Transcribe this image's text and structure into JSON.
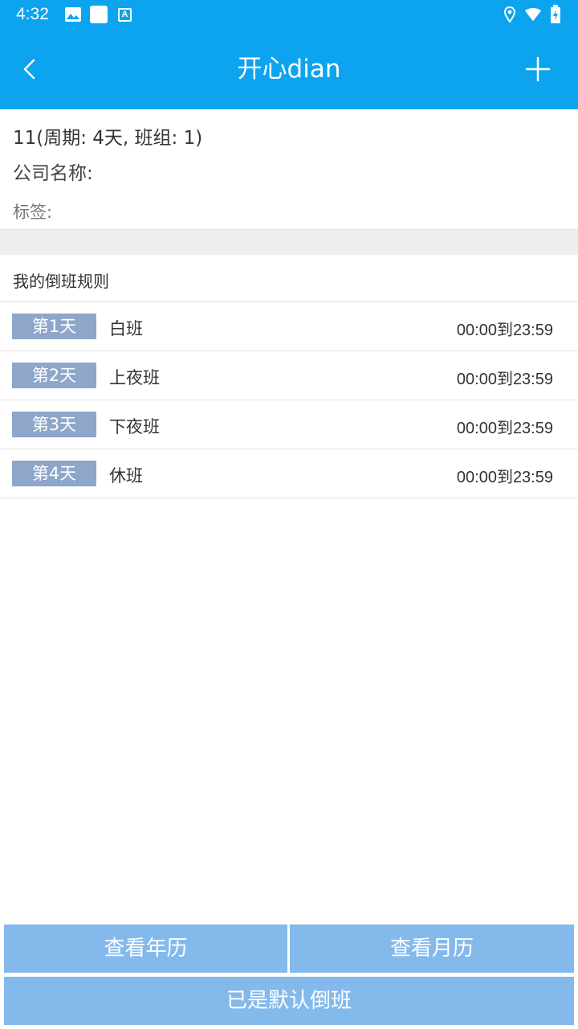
{
  "status_bar": {
    "time": "4:32",
    "left_icons": [
      "image-icon",
      "square-icon",
      "font-a-icon"
    ],
    "right_icons": [
      "location-icon",
      "wifi-icon",
      "battery-charging-icon"
    ],
    "a_glyph": "A"
  },
  "app_bar": {
    "title": "开心dian",
    "back_icon": "chevron-left-icon",
    "add_icon": "plus-icon"
  },
  "info": {
    "name_line": "11(周期: 4天, 班组: 1)",
    "company_label": "公司名称:",
    "tags_label": "标签:"
  },
  "rules": {
    "header": "我的倒班规则",
    "items": [
      {
        "day": "第1天",
        "shift": "白班",
        "time": "00:00到23:59"
      },
      {
        "day": "第2天",
        "shift": "上夜班",
        "time": "00:00到23:59"
      },
      {
        "day": "第3天",
        "shift": "下夜班",
        "time": "00:00到23:59"
      },
      {
        "day": "第4天",
        "shift": "休班",
        "time": "00:00到23:59"
      }
    ]
  },
  "buttons": {
    "view_year": "查看年历",
    "view_month": "查看月历",
    "default": "已是默认倒班"
  },
  "colors": {
    "primary": "#0ca4ef",
    "day_tag": "#8ea6c9",
    "button": "#84b9ec"
  }
}
